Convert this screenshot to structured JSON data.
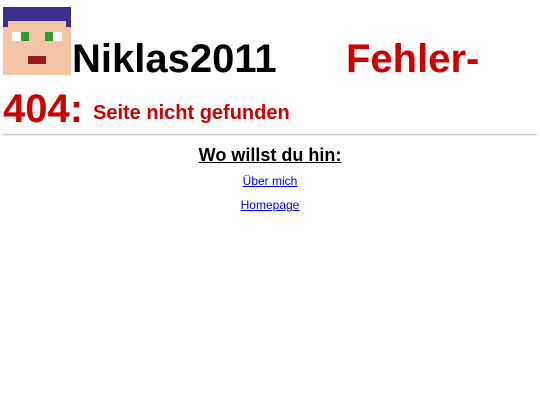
{
  "header": {
    "avatar_icon": "pixel-face-icon",
    "site_name": "Niklas2011",
    "error_word": "Fehler-",
    "error_code": "404:",
    "error_message": "Seite nicht gefunden"
  },
  "nav": {
    "heading": "Wo willst du hin:",
    "links": [
      {
        "label": "Über mich"
      },
      {
        "label": "Homepage"
      }
    ]
  },
  "colors": {
    "error_red": "#cc0000",
    "link_blue": "#0000ee",
    "hair": "#3a2f8a",
    "skin": "#f4c5a4",
    "eye": "#2aa02a",
    "mouth": "#9b1b1b"
  }
}
